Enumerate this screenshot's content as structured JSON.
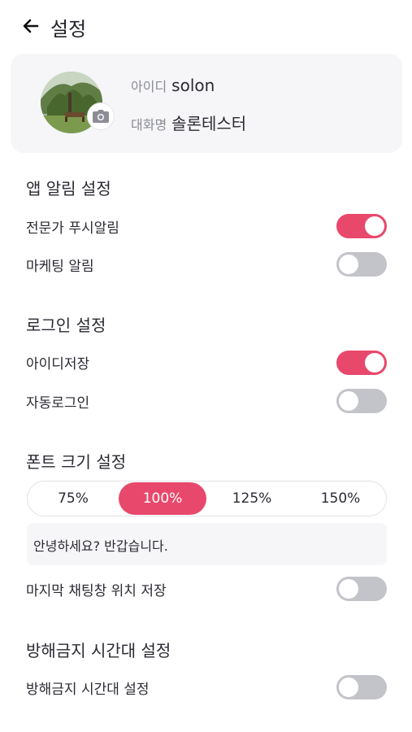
{
  "header": {
    "title": "설정"
  },
  "profile": {
    "id_label": "아이디",
    "id_value": "solon",
    "nickname_label": "대화명",
    "nickname_value": "솔론테스터"
  },
  "sections": {
    "notifications": {
      "title": "앱 알림 설정",
      "expert_push_label": "전문가 푸시알림",
      "expert_push_on": true,
      "marketing_label": "마케팅 알림",
      "marketing_on": false
    },
    "login": {
      "title": "로그인 설정",
      "save_id_label": "아이디저장",
      "save_id_on": true,
      "auto_login_label": "자동로그인",
      "auto_login_on": false
    },
    "font": {
      "title": "폰트 크기 설정",
      "options": [
        "75%",
        "100%",
        "125%",
        "150%"
      ],
      "selected": "100%",
      "preview_text": "안녕하세요? 반갑습니다.",
      "save_chat_position_label": "마지막 채팅창 위치 저장",
      "save_chat_position_on": false
    },
    "dnd": {
      "title": "방해금지 시간대 설정",
      "toggle_label": "방해금지 시간대 설정",
      "toggle_on": false
    }
  },
  "colors": {
    "accent": "#e8486c",
    "toggle_off": "#c3c3ca",
    "card_bg": "#f6f6f8"
  },
  "icons": {
    "back": "arrow-left-icon",
    "camera": "camera-icon"
  }
}
